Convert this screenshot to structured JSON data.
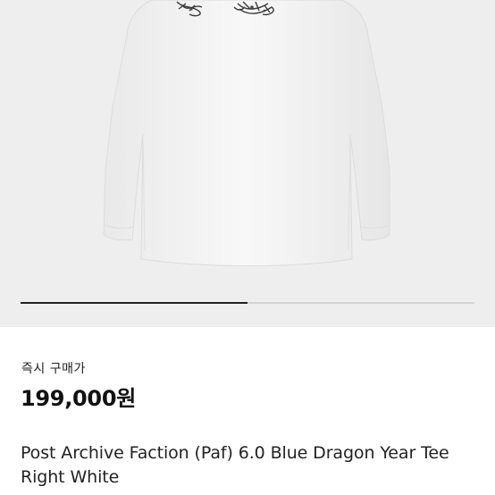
{
  "product": {
    "image_alt": "white-long-sleeve-tee-with-dragon-print",
    "gallery_progress": 0.5,
    "price_label": "즉시 구매가",
    "price": "199,000원",
    "title": "Post Archive Faction (Paf) 6.0 Blue Dragon Year Tee Right White"
  },
  "colors": {
    "image_background": "#efeeef",
    "indicator_track": "#d6d5d6",
    "indicator_active": "#222222",
    "text_primary": "#222222"
  }
}
